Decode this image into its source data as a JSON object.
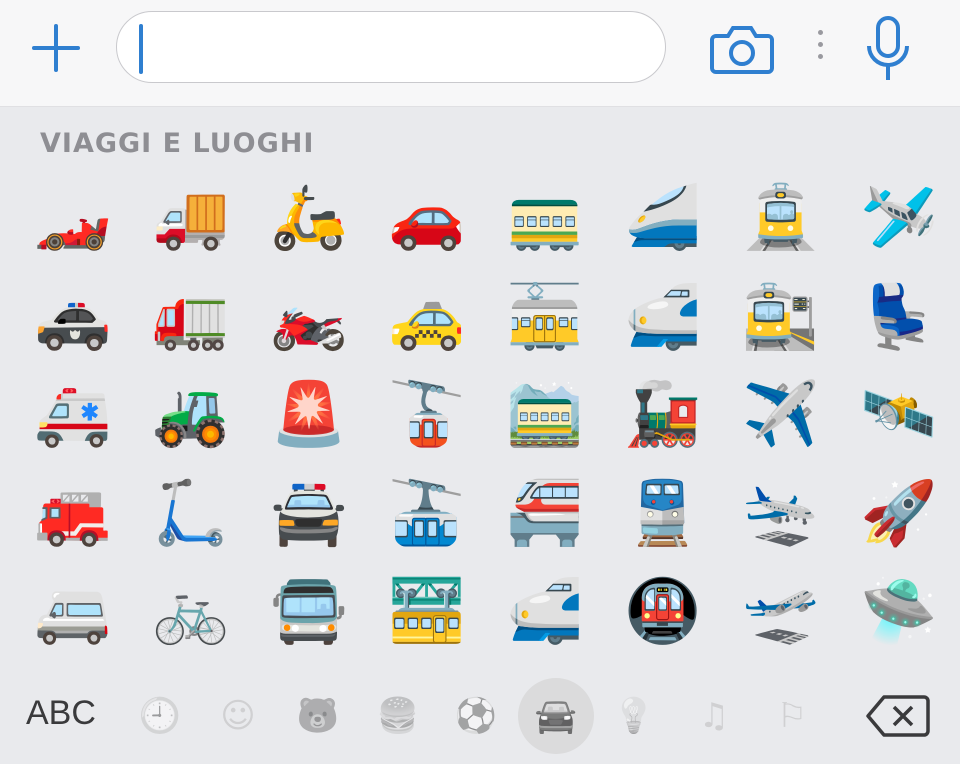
{
  "header": {
    "add_icon": "plus-icon",
    "input_value": "",
    "camera_icon": "camera-icon",
    "more_icon": "more-vertical-icon",
    "mic_icon": "microphone-icon",
    "accent_color": "#2f7fd0"
  },
  "section": {
    "title": "VIAGGI E LUOGHI"
  },
  "emoji_rows": [
    [
      "🏎️",
      "🚚",
      "🛵",
      "🚗",
      "🚃",
      "🚄",
      "🚊",
      "🛩️"
    ],
    [
      "🚓",
      "🚛",
      "🏍️",
      "🚕",
      "🚋",
      "🚅",
      "🚉",
      "💺"
    ],
    [
      "🚑",
      "🚜",
      "🚨",
      "🚡",
      "🚞",
      "🚂",
      "✈️",
      "🛰️"
    ],
    [
      "🚒",
      "🛴",
      "🚔",
      "🚠",
      "🚝",
      "🚆",
      "🛬",
      "🚀"
    ],
    [
      "🚐",
      "🚲",
      "🚍",
      "🚟",
      "🚅",
      "🚇",
      "🛫",
      "🛸"
    ]
  ],
  "footer": {
    "abc_label": "ABC",
    "categories": [
      {
        "name": "recent-clock-icon",
        "glyph": "🕘"
      },
      {
        "name": "smiley-icon",
        "glyph": "☺"
      },
      {
        "name": "animal-bear-icon",
        "glyph": "🐻"
      },
      {
        "name": "food-icon",
        "glyph": "🍔"
      },
      {
        "name": "soccer-ball-icon",
        "glyph": "⚽"
      },
      {
        "name": "travel-car-icon",
        "glyph": "🚘",
        "selected": true
      },
      {
        "name": "lightbulb-icon",
        "glyph": "💡"
      },
      {
        "name": "symbols-icon",
        "glyph": "♫"
      },
      {
        "name": "flag-icon",
        "glyph": "⚐"
      }
    ],
    "backspace_icon": "backspace-icon"
  }
}
